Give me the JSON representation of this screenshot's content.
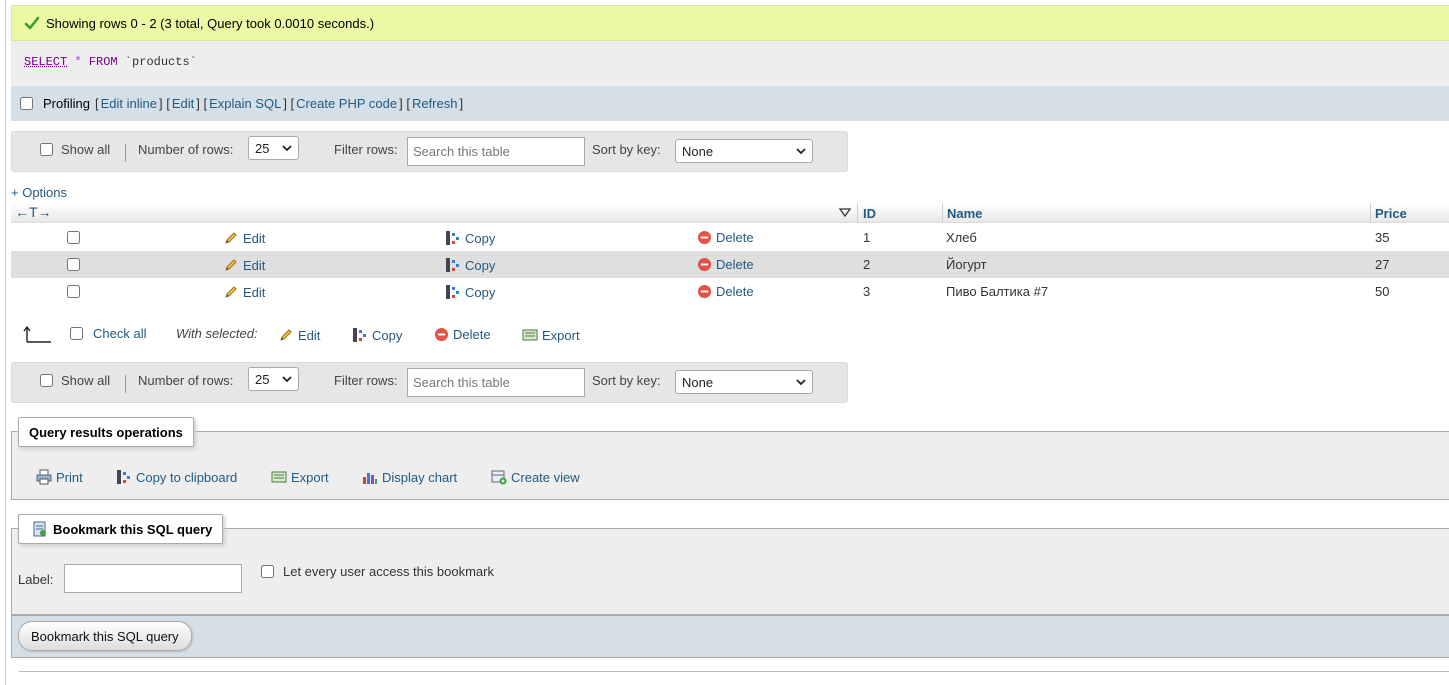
{
  "message": {
    "text": "Showing rows 0 - 2 (3 total, Query took 0.0010 seconds.)",
    "accent": "#ebf8a4"
  },
  "sql": {
    "select": "SELECT",
    "star": "*",
    "from": "FROM",
    "table": "`products`"
  },
  "tools": {
    "profiling": "Profiling",
    "links": [
      "Edit inline",
      "Edit",
      "Explain SQL",
      "Create PHP code",
      "Refresh"
    ]
  },
  "nav": {
    "show_all": "Show all",
    "rows_label": "Number of rows:",
    "rows_value": "25",
    "filter_label": "Filter rows:",
    "filter_placeholder": "Search this table",
    "sort_label": "Sort by key:",
    "sort_value": "None"
  },
  "options_link": "+ Options",
  "table": {
    "arrows": "←T→",
    "columns": [
      "ID",
      "Name",
      "Price"
    ],
    "actions": {
      "edit": "Edit",
      "copy": "Copy",
      "delete": "Delete"
    },
    "rows": [
      {
        "id": "1",
        "name": "Хлеб",
        "price": "35"
      },
      {
        "id": "2",
        "name": "Йогурт",
        "price": "27"
      },
      {
        "id": "3",
        "name": "Пиво Балтика #7",
        "price": "50"
      }
    ]
  },
  "with_selected": {
    "check_all": "Check all",
    "label": "With selected:",
    "edit": "Edit",
    "copy": "Copy",
    "delete": "Delete",
    "export": "Export"
  },
  "query_ops": {
    "legend": "Query results operations",
    "items": {
      "print": "Print",
      "clipboard": "Copy to clipboard",
      "export": "Export",
      "chart": "Display chart",
      "view": "Create view"
    }
  },
  "bookmark": {
    "legend": "Bookmark this SQL query",
    "label": "Label:",
    "label_value": "",
    "public": "Let every user access this bookmark",
    "button": "Bookmark this SQL query"
  },
  "colors": {
    "link": "#235a81",
    "stripe": "#dfdfdf",
    "tools_bg": "#d5dfe7"
  },
  "icons": [
    "check-icon",
    "pencil-icon",
    "copy-icon",
    "delete-icon",
    "export-icon",
    "print-icon",
    "chart-icon",
    "view-icon",
    "bookmark-icon",
    "sort-down-icon",
    "check-all-arrow-icon"
  ]
}
